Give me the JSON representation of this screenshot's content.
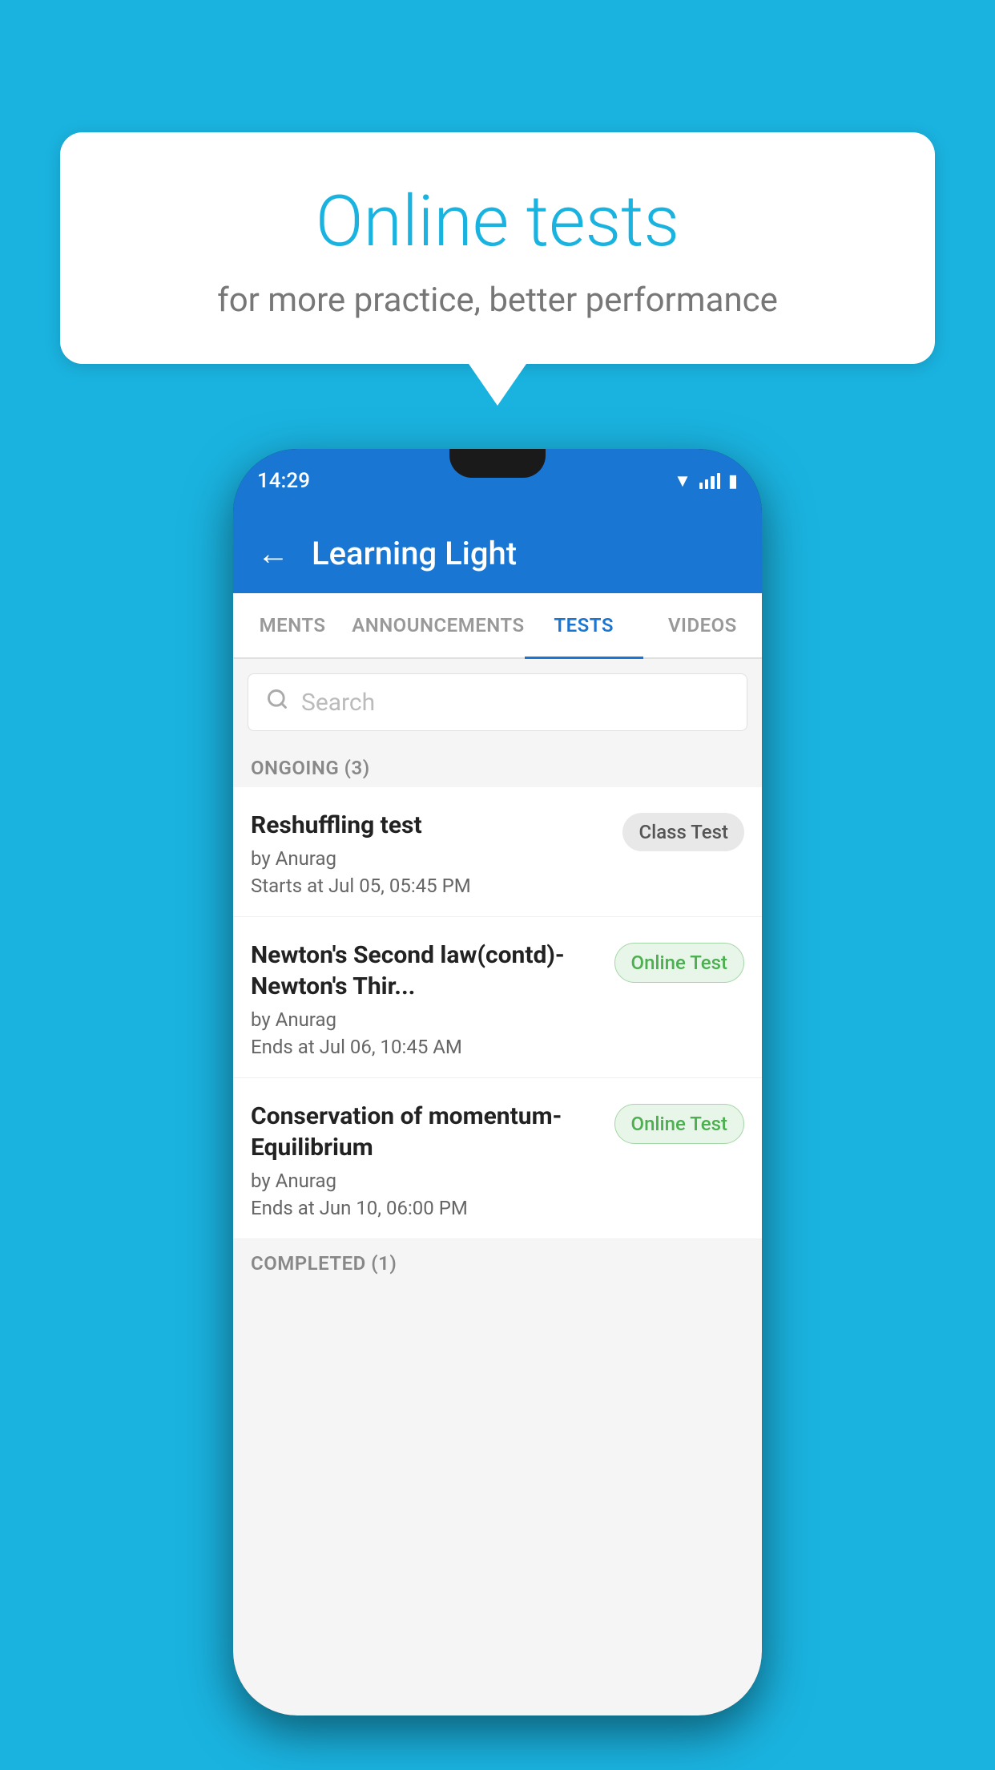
{
  "background_color": "#1ab3e0",
  "bubble": {
    "title": "Online tests",
    "subtitle": "for more practice, better performance"
  },
  "phone": {
    "status": {
      "time": "14:29"
    },
    "header": {
      "back_label": "←",
      "title": "Learning Light"
    },
    "tabs": [
      {
        "id": "ments",
        "label": "MENTS",
        "active": false
      },
      {
        "id": "announcements",
        "label": "ANNOUNCEMENTS",
        "active": false
      },
      {
        "id": "tests",
        "label": "TESTS",
        "active": true
      },
      {
        "id": "videos",
        "label": "VIDEOS",
        "active": false
      }
    ],
    "search": {
      "placeholder": "Search"
    },
    "ongoing_label": "ONGOING (3)",
    "tests": [
      {
        "id": "test-1",
        "name": "Reshuffling test",
        "author": "by Anurag",
        "time_label": "Starts at",
        "time": "Jul 05, 05:45 PM",
        "badge": "Class Test",
        "badge_type": "class"
      },
      {
        "id": "test-2",
        "name": "Newton's Second law(contd)-Newton's Thir...",
        "author": "by Anurag",
        "time_label": "Ends at",
        "time": "Jul 06, 10:45 AM",
        "badge": "Online Test",
        "badge_type": "online"
      },
      {
        "id": "test-3",
        "name": "Conservation of momentum-Equilibrium",
        "author": "by Anurag",
        "time_label": "Ends at",
        "time": "Jun 10, 06:00 PM",
        "badge": "Online Test",
        "badge_type": "online"
      }
    ],
    "completed_label": "COMPLETED (1)"
  }
}
